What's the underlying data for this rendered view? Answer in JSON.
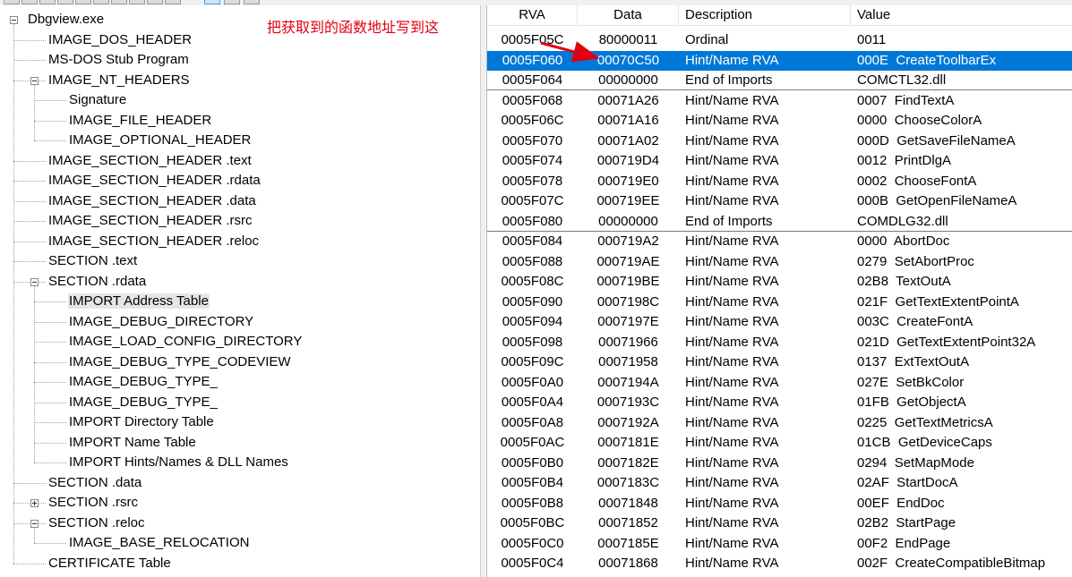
{
  "colors": {
    "selection": "#0078d7",
    "annotation": "#e0000f",
    "tree_line": "#a0a0a0"
  },
  "annotation": {
    "text": "把获取到的函数地址写到这"
  },
  "tree": {
    "nodes": [
      {
        "label": "Dbgview.exe",
        "expander": "minus"
      },
      {
        "label": "IMAGE_DOS_HEADER"
      },
      {
        "label": "MS-DOS Stub Program"
      },
      {
        "label": "IMAGE_NT_HEADERS",
        "expander": "minus"
      },
      {
        "label": "Signature"
      },
      {
        "label": "IMAGE_FILE_HEADER"
      },
      {
        "label": "IMAGE_OPTIONAL_HEADER"
      },
      {
        "label": "IMAGE_SECTION_HEADER .text"
      },
      {
        "label": "IMAGE_SECTION_HEADER .rdata"
      },
      {
        "label": "IMAGE_SECTION_HEADER .data"
      },
      {
        "label": "IMAGE_SECTION_HEADER .rsrc"
      },
      {
        "label": "IMAGE_SECTION_HEADER .reloc"
      },
      {
        "label": "SECTION .text"
      },
      {
        "label": "SECTION .rdata",
        "expander": "minus"
      },
      {
        "label": "IMPORT Address Table",
        "selected": true
      },
      {
        "label": "IMAGE_DEBUG_DIRECTORY"
      },
      {
        "label": "IMAGE_LOAD_CONFIG_DIRECTORY"
      },
      {
        "label": "IMAGE_DEBUG_TYPE_CODEVIEW"
      },
      {
        "label": "IMAGE_DEBUG_TYPE_"
      },
      {
        "label": "IMAGE_DEBUG_TYPE_"
      },
      {
        "label": "IMPORT Directory Table"
      },
      {
        "label": "IMPORT Name Table"
      },
      {
        "label": "IMPORT Hints/Names & DLL Names"
      },
      {
        "label": "SECTION .data"
      },
      {
        "label": "SECTION .rsrc",
        "expander": "plus"
      },
      {
        "label": "SECTION .reloc",
        "expander": "minus"
      },
      {
        "label": "IMAGE_BASE_RELOCATION"
      },
      {
        "label": "CERTIFICATE Table"
      }
    ]
  },
  "list": {
    "columns": [
      "RVA",
      "Data",
      "Description",
      "Value"
    ],
    "rows": [
      {
        "rva": "0005F05C",
        "data": "80000011",
        "desc": "Ordinal",
        "value": "0011"
      },
      {
        "rva": "0005F060",
        "data": "00070C50",
        "desc": "Hint/Name RVA",
        "value": "000E  CreateToolbarEx",
        "selected": true
      },
      {
        "rva": "0005F064",
        "data": "00000000",
        "desc": "End of Imports",
        "value": "COMCTL32.dll",
        "separator": true
      },
      {
        "rva": "0005F068",
        "data": "00071A26",
        "desc": "Hint/Name RVA",
        "value": "0007  FindTextA"
      },
      {
        "rva": "0005F06C",
        "data": "00071A16",
        "desc": "Hint/Name RVA",
        "value": "0000  ChooseColorA"
      },
      {
        "rva": "0005F070",
        "data": "00071A02",
        "desc": "Hint/Name RVA",
        "value": "000D  GetSaveFileNameA"
      },
      {
        "rva": "0005F074",
        "data": "000719D4",
        "desc": "Hint/Name RVA",
        "value": "0012  PrintDlgA"
      },
      {
        "rva": "0005F078",
        "data": "000719E0",
        "desc": "Hint/Name RVA",
        "value": "0002  ChooseFontA"
      },
      {
        "rva": "0005F07C",
        "data": "000719EE",
        "desc": "Hint/Name RVA",
        "value": "000B  GetOpenFileNameA"
      },
      {
        "rva": "0005F080",
        "data": "00000000",
        "desc": "End of Imports",
        "value": "COMDLG32.dll",
        "separator": true
      },
      {
        "rva": "0005F084",
        "data": "000719A2",
        "desc": "Hint/Name RVA",
        "value": "0000  AbortDoc"
      },
      {
        "rva": "0005F088",
        "data": "000719AE",
        "desc": "Hint/Name RVA",
        "value": "0279  SetAbortProc"
      },
      {
        "rva": "0005F08C",
        "data": "000719BE",
        "desc": "Hint/Name RVA",
        "value": "02B8  TextOutA"
      },
      {
        "rva": "0005F090",
        "data": "0007198C",
        "desc": "Hint/Name RVA",
        "value": "021F  GetTextExtentPointA"
      },
      {
        "rva": "0005F094",
        "data": "0007197E",
        "desc": "Hint/Name RVA",
        "value": "003C  CreateFontA"
      },
      {
        "rva": "0005F098",
        "data": "00071966",
        "desc": "Hint/Name RVA",
        "value": "021D  GetTextExtentPoint32A"
      },
      {
        "rva": "0005F09C",
        "data": "00071958",
        "desc": "Hint/Name RVA",
        "value": "0137  ExtTextOutA"
      },
      {
        "rva": "0005F0A0",
        "data": "0007194A",
        "desc": "Hint/Name RVA",
        "value": "027E  SetBkColor"
      },
      {
        "rva": "0005F0A4",
        "data": "0007193C",
        "desc": "Hint/Name RVA",
        "value": "01FB  GetObjectA"
      },
      {
        "rva": "0005F0A8",
        "data": "0007192A",
        "desc": "Hint/Name RVA",
        "value": "0225  GetTextMetricsA"
      },
      {
        "rva": "0005F0AC",
        "data": "0007181E",
        "desc": "Hint/Name RVA",
        "value": "01CB  GetDeviceCaps"
      },
      {
        "rva": "0005F0B0",
        "data": "0007182E",
        "desc": "Hint/Name RVA",
        "value": "0294  SetMapMode"
      },
      {
        "rva": "0005F0B4",
        "data": "0007183C",
        "desc": "Hint/Name RVA",
        "value": "02AF  StartDocA"
      },
      {
        "rva": "0005F0B8",
        "data": "00071848",
        "desc": "Hint/Name RVA",
        "value": "00EF  EndDoc"
      },
      {
        "rva": "0005F0BC",
        "data": "00071852",
        "desc": "Hint/Name RVA",
        "value": "02B2  StartPage"
      },
      {
        "rva": "0005F0C0",
        "data": "0007185E",
        "desc": "Hint/Name RVA",
        "value": "00F2  EndPage"
      },
      {
        "rva": "0005F0C4",
        "data": "00071868",
        "desc": "Hint/Name RVA",
        "value": "002F  CreateCompatibleBitmap"
      }
    ]
  }
}
